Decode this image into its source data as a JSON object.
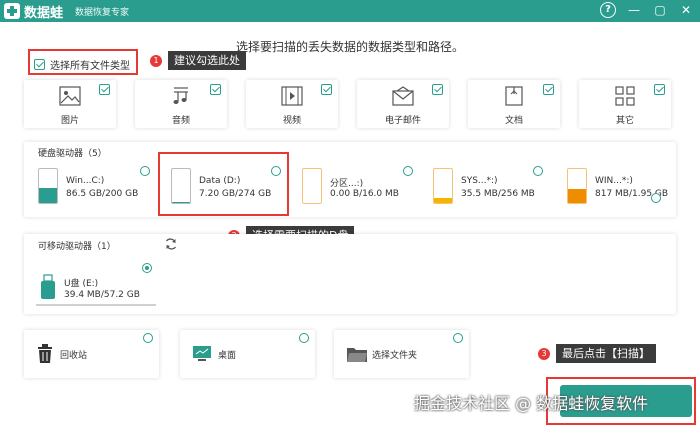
{
  "app": {
    "brand": "数据蛙",
    "slogan": "数据恢复专家"
  },
  "window": {
    "help": "?",
    "minimize": "—",
    "restore": "▢",
    "close": "✕"
  },
  "instruction": "选择要扫描的丢失数据的数据类型和路径。",
  "select_all": {
    "label": "选择所有文件类型",
    "checked": true
  },
  "callouts": [
    {
      "num": "1",
      "text": "建议勾选此处"
    },
    {
      "num": "2",
      "text": "选择需要扫描的D盘"
    },
    {
      "num": "3",
      "text": "最后点击【扫描】"
    }
  ],
  "file_types": [
    {
      "label": "图片",
      "icon": "image-icon",
      "checked": true
    },
    {
      "label": "音频",
      "icon": "music-icon",
      "checked": true
    },
    {
      "label": "视频",
      "icon": "video-icon",
      "checked": true
    },
    {
      "label": "电子邮件",
      "icon": "mail-icon",
      "checked": true
    },
    {
      "label": "文档",
      "icon": "document-icon",
      "checked": true
    },
    {
      "label": "其它",
      "icon": "other-icon",
      "checked": true
    }
  ],
  "hard_drives": {
    "title": "硬盘驱动器（5）",
    "items": [
      {
        "name": "Win...C:)",
        "size": "86.5 GB/200 GB",
        "used": 0.43,
        "color": "#2a9d8f",
        "selected": false
      },
      {
        "name": "Data (D:)",
        "size": "7.20 GB/274 GB",
        "used": 0.03,
        "color": "#2a9d8f",
        "selected": false
      },
      {
        "name": "分区...:)",
        "size": "0.00  B/16.0 MB",
        "used": 0.0,
        "color": "#f5a623",
        "selected": false
      },
      {
        "name": "SYS...*:)",
        "size": "35.5 MB/256 MB",
        "used": 0.14,
        "color": "#f5b400",
        "selected": false
      },
      {
        "name": "WIN...*:)",
        "size": "817 MB/1.95 GB",
        "used": 0.42,
        "color": "#f08c00",
        "selected": false
      }
    ]
  },
  "removable_drives": {
    "title": "可移动驱动器（1）",
    "refresh_icon": "refresh-icon",
    "items": [
      {
        "name": "U盘 (E:)",
        "size": "39.4 MB/57.2 GB",
        "selected": true
      }
    ]
  },
  "locations": [
    {
      "label": "回收站",
      "icon": "recycle-bin-icon"
    },
    {
      "label": "桌面",
      "icon": "desktop-icon"
    },
    {
      "label": "选择文件夹",
      "icon": "folder-icon"
    }
  ],
  "watermark": "掘金技术社区 @ 数据蛙恢复软件",
  "colors": {
    "accent": "#2a9d8f",
    "highlight": "#e53935",
    "tip_bg": "#3b3b3b"
  }
}
